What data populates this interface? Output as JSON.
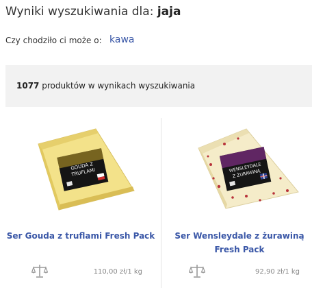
{
  "header": {
    "title_prefix": "Wyniki wyszukiwania dla:",
    "query": "jaja"
  },
  "suggestion": {
    "label": "Czy chodziło ci może o:",
    "term": "kawa"
  },
  "results": {
    "count": "1077",
    "count_label": "produktów w wynikach wyszukiwania"
  },
  "products": [
    {
      "name": "Ser Gouda z truflami Fresh Pack",
      "price": "110,00 zł/1 kg",
      "label_text": "GOUDA Z TRUFLAMI",
      "image_icon": "cheese-wedge-yellow",
      "scale_icon": "balance-scale-icon"
    },
    {
      "name": "Ser Wensleydale z żurawiną Fresh Pack",
      "price": "92,90 zł/1 kg",
      "label_text": "WENSLEYDALE Z ŻURAWINĄ",
      "image_icon": "cheese-wedge-cranberry",
      "scale_icon": "balance-scale-icon"
    }
  ],
  "colors": {
    "link": "#3a57a7",
    "count_bar_bg": "#f2f2f2",
    "price_text": "#888888"
  }
}
